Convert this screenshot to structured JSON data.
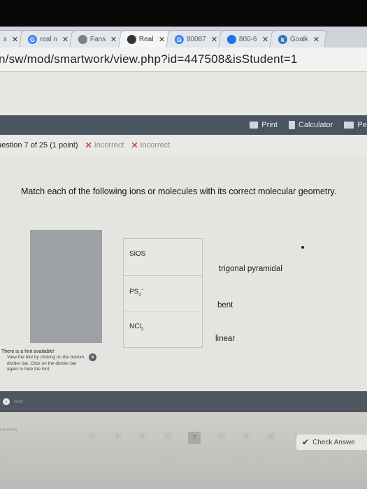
{
  "browser": {
    "tabs": [
      {
        "label": "x",
        "icon": "close-icon",
        "color": "#9aa0a6"
      },
      {
        "label": "real n",
        "icon": "google-icon",
        "color": "#4285f4"
      },
      {
        "label": "Fans",
        "icon": "fans-icon",
        "color": "#7a7f86"
      },
      {
        "label": "Real",
        "icon": "chegg-icon",
        "color": "#333333"
      },
      {
        "label": "80087",
        "icon": "google-icon",
        "color": "#4285f4"
      },
      {
        "label": "800-6",
        "icon": "phone-icon",
        "color": "#1a73e8"
      },
      {
        "label": "Goalk",
        "icon": "k-icon",
        "color": "#2b7bbb"
      }
    ],
    "url": "n/sw/mod/smartwork/view.php?id=447508&isStudent=1"
  },
  "toolbar": {
    "print": "Print",
    "calculator": "Calculator",
    "pen": "Pen"
  },
  "question": {
    "number": "uestion 7 of 25 (1 point)",
    "attempts": [
      "Incorrect",
      "Incorrect"
    ],
    "prompt": "Match each of the following ions or molecules with its correct molecular geometry."
  },
  "answers": [
    {
      "label": "SiOS"
    },
    {
      "label": "PS",
      "sub": "2",
      "sup": "−"
    },
    {
      "label": "NCl",
      "sub": "3"
    }
  ],
  "geometries": [
    "trigonal pyramidal",
    "bent",
    "linear"
  ],
  "hint": {
    "title": "There is a hint available!",
    "body": "View the hint by clicking on the bottom divider bar. Click on the divider bar again to hide the hint.",
    "bar_label": "Hint"
  },
  "footer": {
    "resources": "sources",
    "pages": [
      "3",
      "4",
      "5",
      "6",
      "7",
      "8",
      "9",
      "10"
    ],
    "current_page": "7",
    "next": "›",
    "check_answer": "Check Answe"
  }
}
